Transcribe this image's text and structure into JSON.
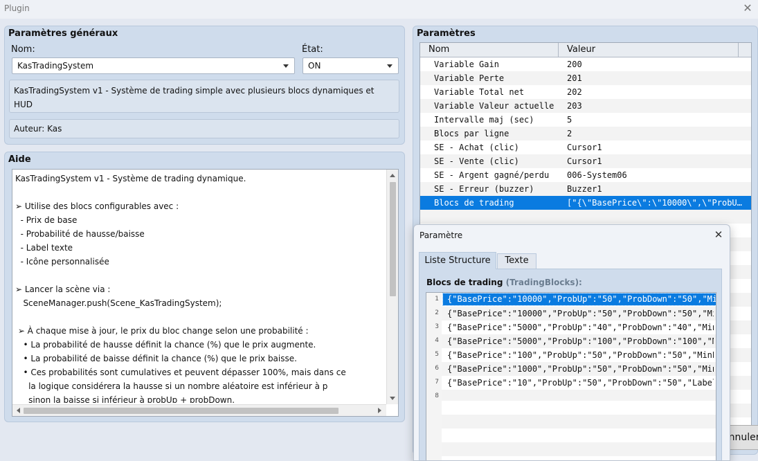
{
  "window": {
    "title": "Plugin",
    "close_glyph": "✕"
  },
  "general": {
    "title": "Paramètres généraux",
    "name_label": "Nom:",
    "name_value": "KasTradingSystem",
    "state_label": "État:",
    "state_value": "ON",
    "description": "KasTradingSystem v1 - Système de trading simple avec plusieurs blocs dynamiques et HUD",
    "author": "Auteur: Kas"
  },
  "help": {
    "title": "Aide",
    "text": "KasTradingSystem v1 - Système de trading dynamique.\n\n➢ Utilise des blocs configurables avec :\n  - Prix de base\n  - Probabilité de hausse/baisse\n  - Label texte\n  - Icône personnalisée\n\n➢ Lancer la scène via :\n   SceneManager.push(Scene_KasTradingSystem);\n\n ➢ À chaque mise à jour, le prix du bloc change selon une probabilité :\n   • La probabilité de hausse définit la chance (%) que le prix augmente.\n   • La probabilité de baisse définit la chance (%) que le prix baisse.\n   • Ces probabilités sont cumulatives et peuvent dépasser 100%, mais dans ce\n     la logique considérera la hausse si un nombre aléatoire est inférieur à p\n     sinon la baisse si inférieur à probUp + probDown."
  },
  "params": {
    "title": "Paramètres",
    "col_name": "Nom",
    "col_value": "Valeur",
    "rows": [
      {
        "name": "Variable Gain",
        "value": "200"
      },
      {
        "name": "Variable Perte",
        "value": "201"
      },
      {
        "name": "Variable Total net",
        "value": "202"
      },
      {
        "name": "Variable Valeur actuelle",
        "value": "203"
      },
      {
        "name": "Intervalle maj (sec)",
        "value": "5"
      },
      {
        "name": "Blocs par ligne",
        "value": "2"
      },
      {
        "name": "SE - Achat (clic)",
        "value": "Cursor1"
      },
      {
        "name": "SE - Vente (clic)",
        "value": "Cursor1"
      },
      {
        "name": "SE - Argent gagné/perdu",
        "value": "006-System06"
      },
      {
        "name": "SE - Erreur (buzzer)",
        "value": "Buzzer1"
      },
      {
        "name": "Blocs de trading",
        "value": "[\"{\\\"BasePrice\\\":\\\"10000\\\",\\\"ProbU…"
      }
    ],
    "selected_index": 10
  },
  "cancel_button": {
    "label": "Annuler"
  },
  "dialog": {
    "title": "Paramètre",
    "close_glyph": "✕",
    "tabs": [
      {
        "label": "Liste Structure"
      },
      {
        "label": "Texte"
      }
    ],
    "active_tab": 0,
    "list_label": "Blocs de trading",
    "list_type": "(TradingBlocks):",
    "rows": [
      {
        "num": "1",
        "text": "{\"BasePrice\":\"10000\",\"ProbUp\":\"50\",\"ProbDown\":\"50\",\"Mi…"
      },
      {
        "num": "2",
        "text": "{\"BasePrice\":\"10000\",\"ProbUp\":\"50\",\"ProbDown\":\"50\",\"Mi…"
      },
      {
        "num": "3",
        "text": "{\"BasePrice\":\"5000\",\"ProbUp\":\"40\",\"ProbDown\":\"40\",\"Min…"
      },
      {
        "num": "4",
        "text": "{\"BasePrice\":\"5000\",\"ProbUp\":\"100\",\"ProbDown\":\"100\",\"M…"
      },
      {
        "num": "5",
        "text": "{\"BasePrice\":\"100\",\"ProbUp\":\"50\",\"ProbDown\":\"50\",\"MinP…"
      },
      {
        "num": "6",
        "text": "{\"BasePrice\":\"1000\",\"ProbUp\":\"50\",\"ProbDown\":\"50\",\"Min…"
      },
      {
        "num": "7",
        "text": "{\"BasePrice\":\"10\",\"ProbUp\":\"50\",\"ProbDown\":\"50\",\"Label…"
      },
      {
        "num": "8",
        "text": ""
      }
    ],
    "selected_index": 0
  }
}
